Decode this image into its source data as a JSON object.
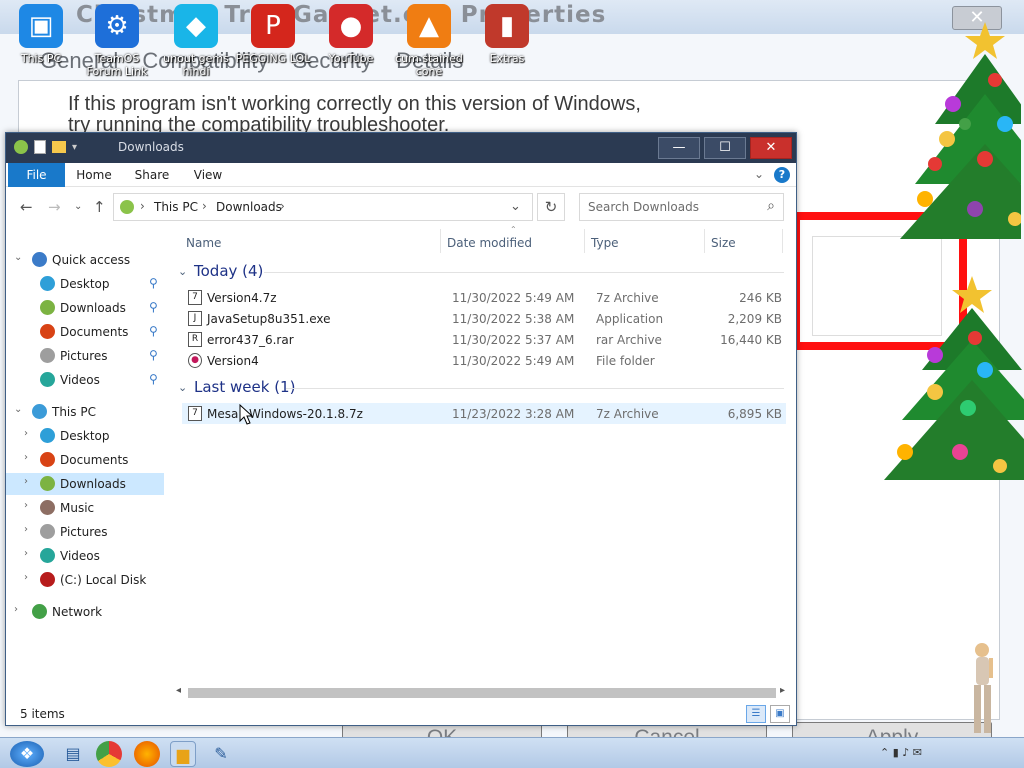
{
  "background_dialog": {
    "title": "Christmas Tree Gadget.exe Properties",
    "close_glyph": "✕",
    "tabs": [
      "General",
      "Compatibility",
      "Security",
      "Details"
    ],
    "text_line1": "If this program isn't working correctly on this version of Windows,",
    "text_line2": "try running the compatibility troubleshooter.",
    "buttons": {
      "ok": "OK",
      "cancel": "Cancel",
      "apply": "Apply"
    }
  },
  "desktop_icons": [
    {
      "label": "This PC",
      "icon": "computer-icon",
      "color": "#1e88e5"
    },
    {
      "label": "TeamOS Forum Link",
      "icon": "gear-icon",
      "color": "#1e6fd9"
    },
    {
      "label": "unout gems hindi",
      "icon": "gem-icon",
      "color": "#19b5e8"
    },
    {
      "label": "PEGGING LOL",
      "icon": "peggle-icon",
      "color": "#d4261c"
    },
    {
      "label": "YouTube",
      "icon": "angry-bird-icon",
      "color": "#d42a2a"
    },
    {
      "label": "cum stained cone",
      "icon": "traffic-cone-icon",
      "color": "#f07d12"
    },
    {
      "label": "Extras",
      "icon": "door-icon",
      "color": "#c0392b"
    }
  ],
  "explorer": {
    "title": "Downloads",
    "ribbon_tabs": {
      "file": "File",
      "home": "Home",
      "share": "Share",
      "view": "View"
    },
    "help_glyph": "?",
    "breadcrumb": {
      "root": "This PC",
      "folder": "Downloads"
    },
    "search_placeholder": "Search Downloads",
    "nav_pane": {
      "quick_access": "Quick access",
      "quick_items": [
        "Desktop",
        "Downloads",
        "Documents",
        "Pictures",
        "Videos"
      ],
      "this_pc": "This PC",
      "pc_items": [
        "Desktop",
        "Documents",
        "Downloads",
        "Music",
        "Pictures",
        "Videos",
        "(C:) Local Disk"
      ],
      "network": "Network",
      "selected": "Downloads"
    },
    "columns": {
      "name": "Name",
      "date": "Date modified",
      "type": "Type",
      "size": "Size"
    },
    "groups": [
      {
        "label": "Today (4)",
        "files": [
          {
            "name": "Version4.7z",
            "date": "11/30/2022 5:49 AM",
            "type": "7z Archive",
            "size": "246 KB"
          },
          {
            "name": "JavaSetup8u351.exe",
            "date": "11/30/2022 5:38 AM",
            "type": "Application",
            "size": "2,209 KB"
          },
          {
            "name": "error437_6.rar",
            "date": "11/30/2022 5:37 AM",
            "type": "rar Archive",
            "size": "16,440 KB"
          },
          {
            "name": "Version4",
            "date": "11/30/2022 5:49 AM",
            "type": "File folder",
            "size": ""
          }
        ]
      },
      {
        "label": "Last week (1)",
        "files": [
          {
            "name": "MesaF Windows-20.1.8.7z",
            "date": "11/23/2022 3:28 AM",
            "type": "7z Archive",
            "size": "6,895 KB"
          }
        ]
      }
    ],
    "status": "5 items"
  },
  "colors": {
    "accent": "#1979ca",
    "titlebar": "#2b3a52",
    "close": "#c9302c",
    "selection": "#cce8ff"
  }
}
